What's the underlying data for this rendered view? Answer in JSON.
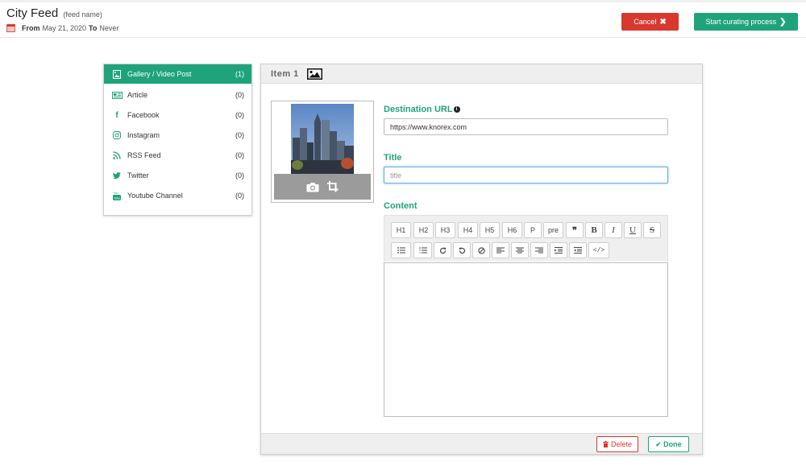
{
  "header": {
    "feed_name": "City Feed",
    "feed_name_hint": "(feed name)",
    "from_label": "From",
    "from_value": "May 21, 2020",
    "to_label": "To",
    "to_value": "Never",
    "cancel_label": "Cancel",
    "start_label": "Start curating process"
  },
  "sidebar": {
    "items": [
      {
        "label": "Gallery / Video Post",
        "count": "(1)",
        "icon": "gallery-icon",
        "active": true
      },
      {
        "label": "Article",
        "count": "(0)",
        "icon": "article-icon",
        "active": false
      },
      {
        "label": "Facebook",
        "count": "(0)",
        "icon": "facebook-icon",
        "active": false
      },
      {
        "label": "Instagram",
        "count": "(0)",
        "icon": "instagram-icon",
        "active": false
      },
      {
        "label": "RSS Feed",
        "count": "(0)",
        "icon": "rss-icon",
        "active": false
      },
      {
        "label": "Twitter",
        "count": "(0)",
        "icon": "twitter-icon",
        "active": false
      },
      {
        "label": "Youtube Channel",
        "count": "(0)",
        "icon": "youtube-icon",
        "active": false
      }
    ]
  },
  "item": {
    "title": "Item 1",
    "destination_label": "Destination URL",
    "destination_value": "https://www.knorex.com",
    "title_label": "Title",
    "title_placeholder": "title",
    "content_label": "Content",
    "delete_label": "Delete",
    "done_label": "Done"
  },
  "toolbar": {
    "row1": [
      "H1",
      "H2",
      "H3",
      "H4",
      "H5",
      "H6",
      "P",
      "pre",
      "quote",
      "B",
      "I",
      "U",
      "S"
    ],
    "row2": [
      "bullet-list",
      "numbered-list",
      "redo",
      "undo",
      "clear",
      "align-left",
      "align-center",
      "align-right",
      "indent",
      "outdent",
      "code"
    ]
  },
  "colors": {
    "accent": "#1fa37a",
    "danger": "#d9382e",
    "focus": "#66aee3"
  }
}
